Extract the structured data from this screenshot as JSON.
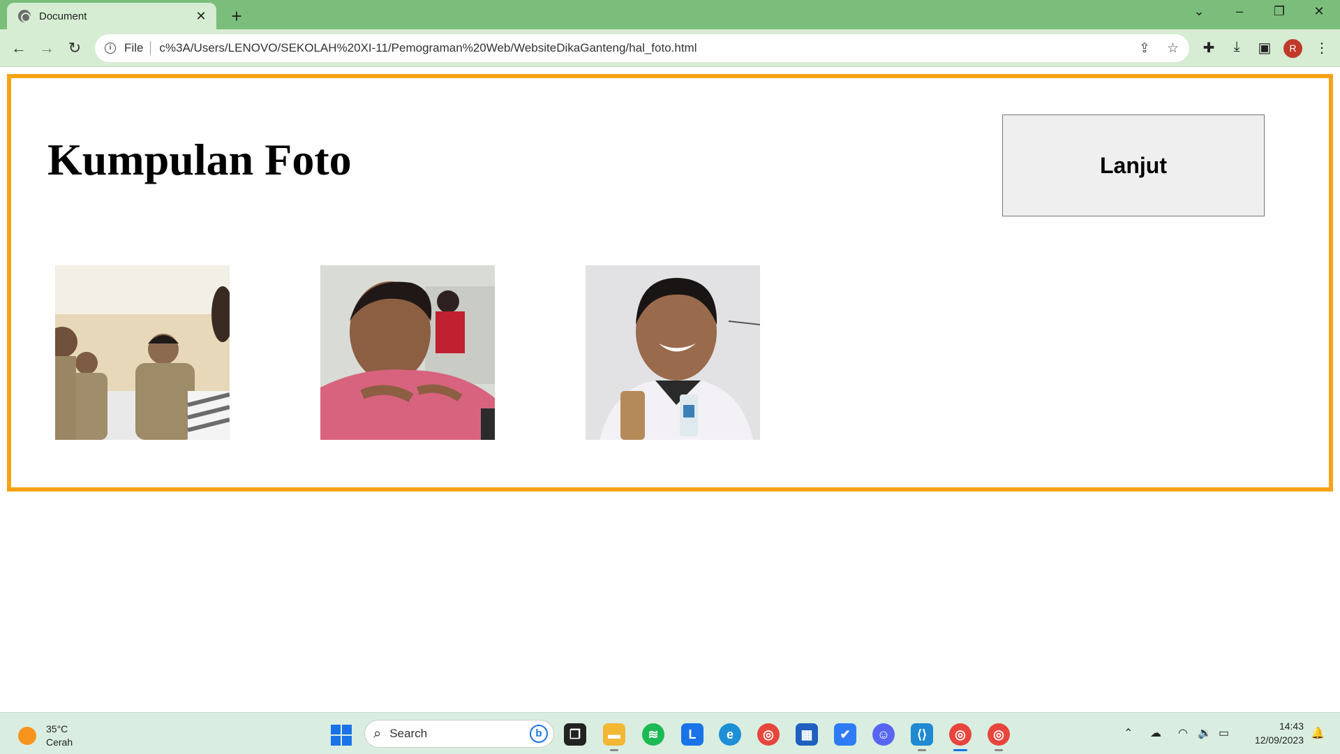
{
  "browser": {
    "tab_title": "Document",
    "address_scheme": "File",
    "address_url": "c%3A/Users/LENOVO/SEKOLAH%20XI-11/Pemograman%20Web/WebsiteDikaGanteng/hal_foto.html",
    "profile_initial": "R"
  },
  "page": {
    "title": "Kumpulan Foto",
    "next_button": "Lanjut",
    "frame_border_color": "#f5a314"
  },
  "photos": [
    {
      "name": "photo-1",
      "description_icon": "photo-classroom"
    },
    {
      "name": "photo-2",
      "description_icon": "photo-pink-shirt"
    },
    {
      "name": "photo-3",
      "description_icon": "photo-smiling"
    }
  ],
  "taskbar": {
    "temperature": "35°C",
    "weather_condition": "Cerah",
    "search_placeholder": "Search",
    "time": "14:43",
    "date": "12/09/2023"
  }
}
